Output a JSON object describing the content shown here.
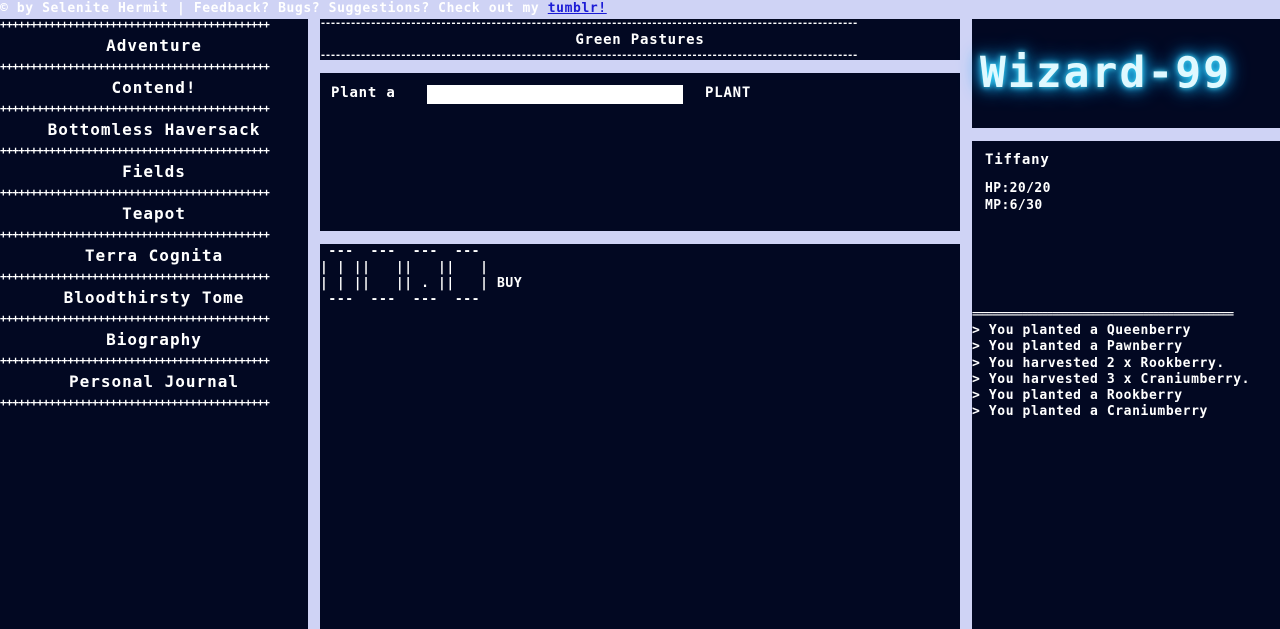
{
  "topbar": {
    "credit": "© by Selenite Hermit | Feedback? Bugs? Suggestions? Check out my",
    "link_label": "tumblr!"
  },
  "sidebar": {
    "separator": "++++++++++++++++++++++++++++++++++++++++++++",
    "items": [
      {
        "label": "Adventure"
      },
      {
        "label": "Contend!"
      },
      {
        "label": "Bottomless Haversack"
      },
      {
        "label": "Fields"
      },
      {
        "label": "Teapot"
      },
      {
        "label": "Terra Cognita"
      },
      {
        "label": "Bloodthirsty Tome"
      },
      {
        "label": "Biography"
      },
      {
        "label": "Personal Journal"
      }
    ]
  },
  "header": {
    "title": "Green Pastures",
    "dashes": "-----------------------------------------------------------------------------------------------------------"
  },
  "plant": {
    "label": "Plant a",
    "input_value": "",
    "button": "PLANT"
  },
  "garden": {
    "row_top": " ---  ---  ---  ---",
    "row_1": "| | ||   ||   ||   |",
    "row_2": "| | ||   || . ||   |",
    "row_bottom": " ---  ---  ---  ---",
    "buy_label": "BUY"
  },
  "logo": {
    "text": "Wizard-99",
    "color": "#3fe0ff"
  },
  "character": {
    "name": "Tiffany",
    "hp": "HP:20/20",
    "mp": "MP:6/30"
  },
  "log": {
    "separator": "====================================================",
    "entries": [
      "> You planted a Queenberry",
      "> You planted a Pawnberry",
      "> You harvested 2 x Rookberry.",
      "> You harvested 3 x Craniumberry.",
      "> You planted a Rookberry",
      "> You planted a Craniumberry"
    ]
  },
  "colors": {
    "panel_bg": "#020822",
    "page_bg": "#cfd3f5",
    "link": "#1b1bd6"
  }
}
